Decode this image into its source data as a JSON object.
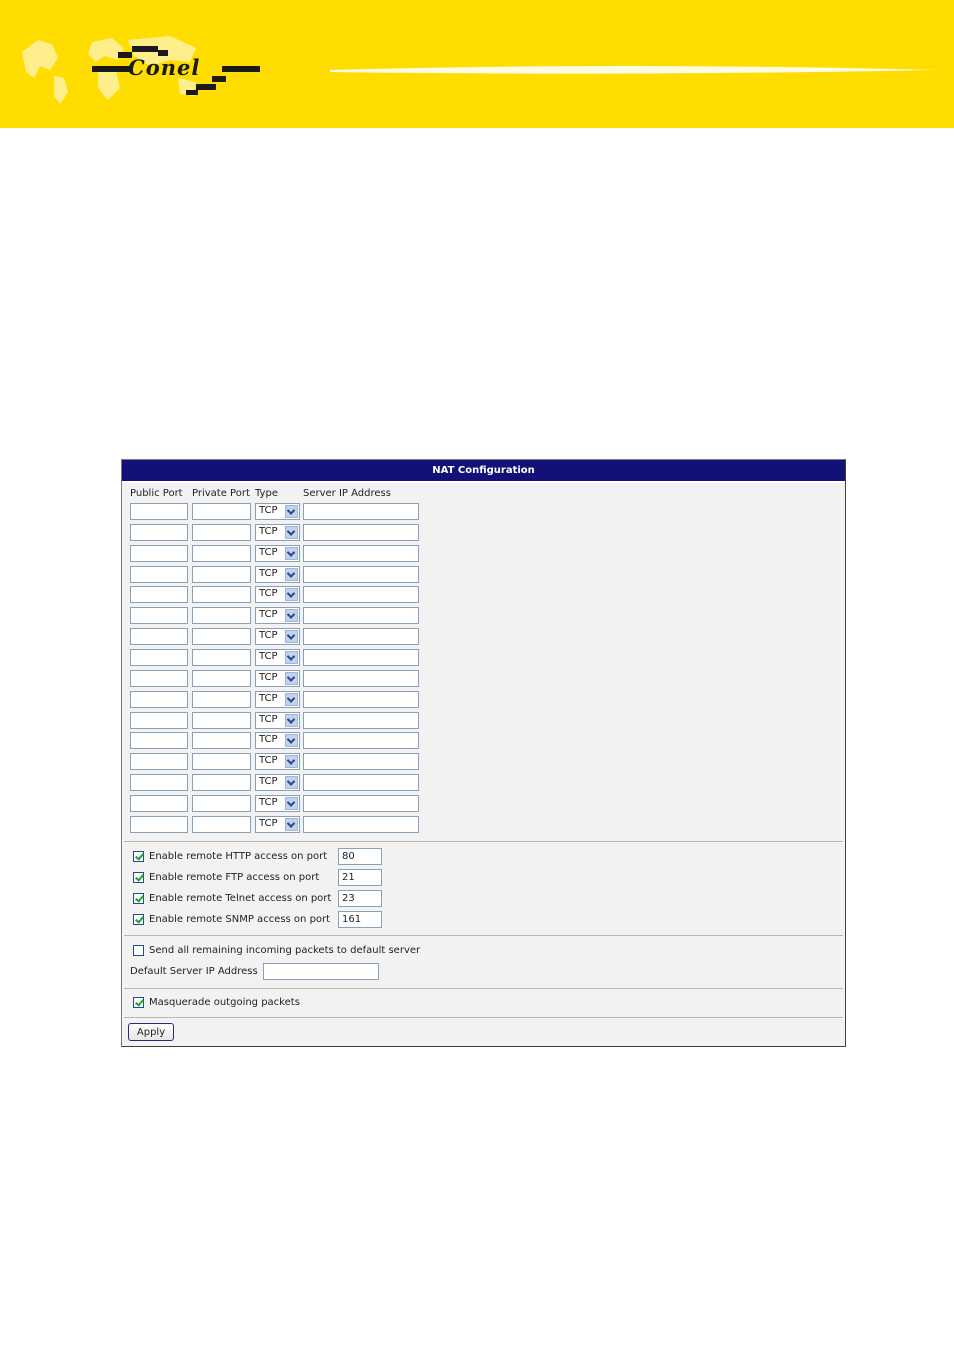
{
  "header": {
    "brand": "Conel",
    "colors": {
      "banner": "#ffdd00",
      "panel_header": "#111177"
    }
  },
  "panel": {
    "title": "NAT Configuration",
    "columns": {
      "public_port": "Public Port",
      "private_port": "Private Port",
      "type": "Type",
      "server_ip": "Server IP Address"
    },
    "rows": [
      {
        "public_port": "",
        "private_port": "",
        "type": "TCP",
        "server_ip": ""
      },
      {
        "public_port": "",
        "private_port": "",
        "type": "TCP",
        "server_ip": ""
      },
      {
        "public_port": "",
        "private_port": "",
        "type": "TCP",
        "server_ip": ""
      },
      {
        "public_port": "",
        "private_port": "",
        "type": "TCP",
        "server_ip": ""
      },
      {
        "public_port": "",
        "private_port": "",
        "type": "TCP",
        "server_ip": ""
      },
      {
        "public_port": "",
        "private_port": "",
        "type": "TCP",
        "server_ip": ""
      },
      {
        "public_port": "",
        "private_port": "",
        "type": "TCP",
        "server_ip": ""
      },
      {
        "public_port": "",
        "private_port": "",
        "type": "TCP",
        "server_ip": ""
      },
      {
        "public_port": "",
        "private_port": "",
        "type": "TCP",
        "server_ip": ""
      },
      {
        "public_port": "",
        "private_port": "",
        "type": "TCP",
        "server_ip": ""
      },
      {
        "public_port": "",
        "private_port": "",
        "type": "TCP",
        "server_ip": ""
      },
      {
        "public_port": "",
        "private_port": "",
        "type": "TCP",
        "server_ip": ""
      },
      {
        "public_port": "",
        "private_port": "",
        "type": "TCP",
        "server_ip": ""
      },
      {
        "public_port": "",
        "private_port": "",
        "type": "TCP",
        "server_ip": ""
      },
      {
        "public_port": "",
        "private_port": "",
        "type": "TCP",
        "server_ip": ""
      },
      {
        "public_port": "",
        "private_port": "",
        "type": "TCP",
        "server_ip": ""
      }
    ],
    "remote_access": [
      {
        "label": "Enable remote HTTP access on port",
        "checked": true,
        "port": "80"
      },
      {
        "label": "Enable remote FTP access on port",
        "checked": true,
        "port": "21"
      },
      {
        "label": "Enable remote Telnet access on port",
        "checked": true,
        "port": "23"
      },
      {
        "label": "Enable remote SNMP access on port",
        "checked": true,
        "port": "161"
      }
    ],
    "default_server": {
      "send_label": "Send all remaining incoming packets to default server",
      "send_checked": false,
      "ip_label": "Default Server IP Address",
      "ip_value": ""
    },
    "masquerade": {
      "label": "Masquerade outgoing packets",
      "checked": true
    },
    "apply_label": "Apply"
  }
}
